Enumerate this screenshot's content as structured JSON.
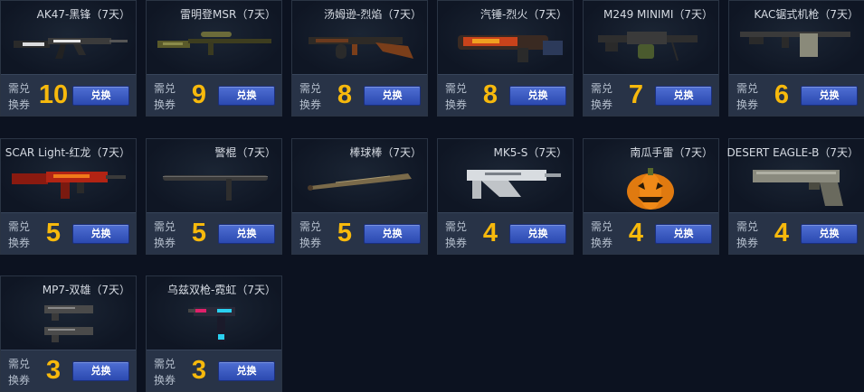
{
  "cost_label": "需兑换券",
  "button_label": "兑换",
  "items": [
    {
      "name": "AK47-黑锋（7天）",
      "cost": "10",
      "icon": "rifle-icon"
    },
    {
      "name": "雷明登MSR（7天）",
      "cost": "9",
      "icon": "sniper-rifle-icon"
    },
    {
      "name": "汤姆逊-烈焰（7天）",
      "cost": "8",
      "icon": "smg-icon"
    },
    {
      "name": "汽锤-烈火（7天）",
      "cost": "8",
      "icon": "heavy-gun-icon"
    },
    {
      "name": "M249 MINIMI（7天）",
      "cost": "7",
      "icon": "machine-gun-icon"
    },
    {
      "name": "KAC锯式机枪（7天）",
      "cost": "6",
      "icon": "machine-gun-icon"
    },
    {
      "name": "SCAR Light-红龙（7天）",
      "cost": "5",
      "icon": "rifle-icon"
    },
    {
      "name": "警棍（7天）",
      "cost": "5",
      "icon": "baton-icon"
    },
    {
      "name": "棒球棒（7天）",
      "cost": "5",
      "icon": "baseball-bat-icon"
    },
    {
      "name": "MK5-S（7天）",
      "cost": "4",
      "icon": "smg-icon"
    },
    {
      "name": "南瓜手雷（7天）",
      "cost": "4",
      "icon": "pumpkin-grenade-icon"
    },
    {
      "name": "DESERT EAGLE-B（7天）",
      "cost": "4",
      "icon": "pistol-icon"
    },
    {
      "name": "MP7-双雄（7天）",
      "cost": "3",
      "icon": "dual-smg-icon"
    },
    {
      "name": "乌兹双枪-霓虹（7天）",
      "cost": "3",
      "icon": "uzi-icon"
    }
  ],
  "colors": {
    "cost": "#f7b90c",
    "button": "#3a5cc4",
    "background": "#0c1220"
  }
}
